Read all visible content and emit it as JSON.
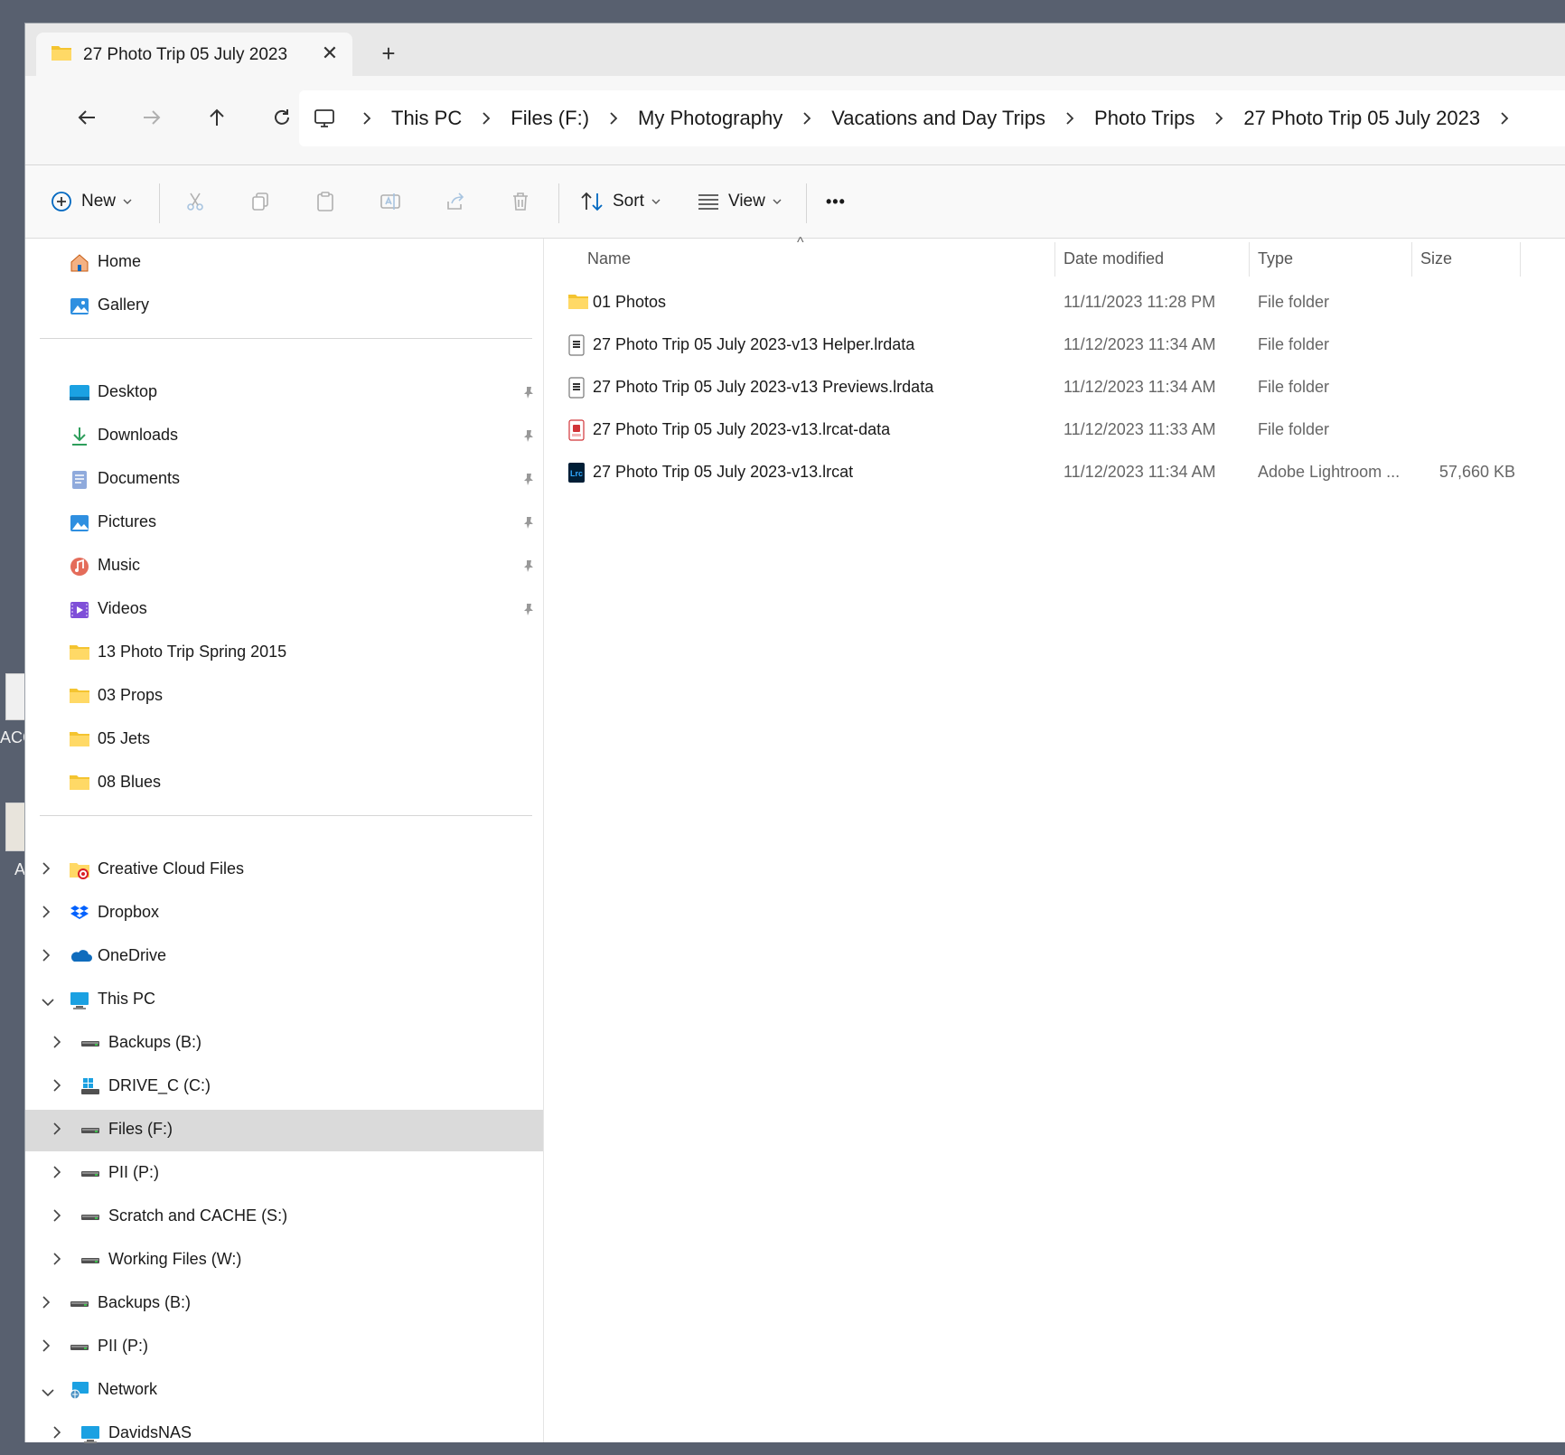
{
  "desktop": {
    "labels": [
      "ACC",
      "A"
    ]
  },
  "tab": {
    "title": "27 Photo Trip 05 July 2023",
    "close": "✕",
    "new": "+"
  },
  "breadcrumb": [
    "This PC",
    "Files (F:)",
    "My Photography",
    "Vacations and Day Trips",
    "Photo Trips",
    "27 Photo Trip 05 July 2023"
  ],
  "toolbar": {
    "new_label": "New",
    "sort_label": "Sort",
    "view_label": "View",
    "more_label": "•••"
  },
  "sidebar": {
    "quick": [
      {
        "label": "Home",
        "icon": "home-icon"
      },
      {
        "label": "Gallery",
        "icon": "gallery-icon"
      }
    ],
    "pinned": [
      {
        "label": "Desktop",
        "icon": "desktop-folder-icon",
        "pinned": true
      },
      {
        "label": "Downloads",
        "icon": "downloads-icon",
        "pinned": true
      },
      {
        "label": "Documents",
        "icon": "documents-icon",
        "pinned": true
      },
      {
        "label": "Pictures",
        "icon": "pictures-icon",
        "pinned": true
      },
      {
        "label": "Music",
        "icon": "music-icon",
        "pinned": true
      },
      {
        "label": "Videos",
        "icon": "videos-icon",
        "pinned": true
      },
      {
        "label": "13 Photo Trip Spring 2015",
        "icon": "folder-icon"
      },
      {
        "label": "03 Props",
        "icon": "folder-icon"
      },
      {
        "label": "05 Jets",
        "icon": "folder-icon"
      },
      {
        "label": "08 Blues",
        "icon": "folder-icon"
      }
    ],
    "tree": [
      {
        "label": "Creative Cloud Files",
        "icon": "creative-cloud-icon",
        "expand": "right",
        "indent": 0
      },
      {
        "label": "Dropbox",
        "icon": "dropbox-icon",
        "expand": "right",
        "indent": 0
      },
      {
        "label": "OneDrive",
        "icon": "onedrive-icon",
        "expand": "right",
        "indent": 0
      },
      {
        "label": "This PC",
        "icon": "pc-icon",
        "expand": "down",
        "indent": 0
      },
      {
        "label": "Backups (B:)",
        "icon": "drive-icon",
        "expand": "right",
        "indent": 1
      },
      {
        "label": "DRIVE_C (C:)",
        "icon": "windows-drive-icon",
        "expand": "right",
        "indent": 1
      },
      {
        "label": "Files (F:)",
        "icon": "drive-icon",
        "expand": "right",
        "indent": 1,
        "selected": true
      },
      {
        "label": "PII (P:)",
        "icon": "drive-icon",
        "expand": "right",
        "indent": 1
      },
      {
        "label": "Scratch and CACHE (S:)",
        "icon": "drive-icon",
        "expand": "right",
        "indent": 1
      },
      {
        "label": "Working Files (W:)",
        "icon": "drive-icon",
        "expand": "right",
        "indent": 1
      },
      {
        "label": "Backups (B:)",
        "icon": "drive-icon",
        "expand": "right",
        "indent": 0
      },
      {
        "label": "PII (P:)",
        "icon": "drive-icon",
        "expand": "right",
        "indent": 0
      },
      {
        "label": "Network",
        "icon": "network-icon",
        "expand": "down",
        "indent": 0
      },
      {
        "label": "DavidsNAS",
        "icon": "pc-icon",
        "expand": "right",
        "indent": 1
      }
    ]
  },
  "columns": {
    "name": "Name",
    "date": "Date modified",
    "type": "Type",
    "size": "Size",
    "sort_indicator": "^"
  },
  "files": [
    {
      "name": "01 Photos",
      "date": "11/11/2023 11:28 PM",
      "type": "File folder",
      "size": "",
      "icon": "folder-icon"
    },
    {
      "name": "27 Photo Trip 05 July 2023-v13 Helper.lrdata",
      "date": "11/12/2023 11:34 AM",
      "type": "File folder",
      "size": "",
      "icon": "lrdata-icon"
    },
    {
      "name": "27 Photo Trip 05 July 2023-v13 Previews.lrdata",
      "date": "11/12/2023 11:34 AM",
      "type": "File folder",
      "size": "",
      "icon": "lrdata-icon"
    },
    {
      "name": "27 Photo Trip 05 July 2023-v13.lrcat-data",
      "date": "11/12/2023 11:33 AM",
      "type": "File folder",
      "size": "",
      "icon": "lrcat-data-icon"
    },
    {
      "name": "27 Photo Trip 05 July 2023-v13.lrcat",
      "date": "11/12/2023 11:34 AM",
      "type": "Adobe Lightroom ...",
      "size": "57,660 KB",
      "icon": "lightroom-catalog-icon"
    }
  ],
  "colors": {
    "accent": "#0067c0",
    "folder": "#f4c430",
    "selected_bg": "#dadada"
  }
}
